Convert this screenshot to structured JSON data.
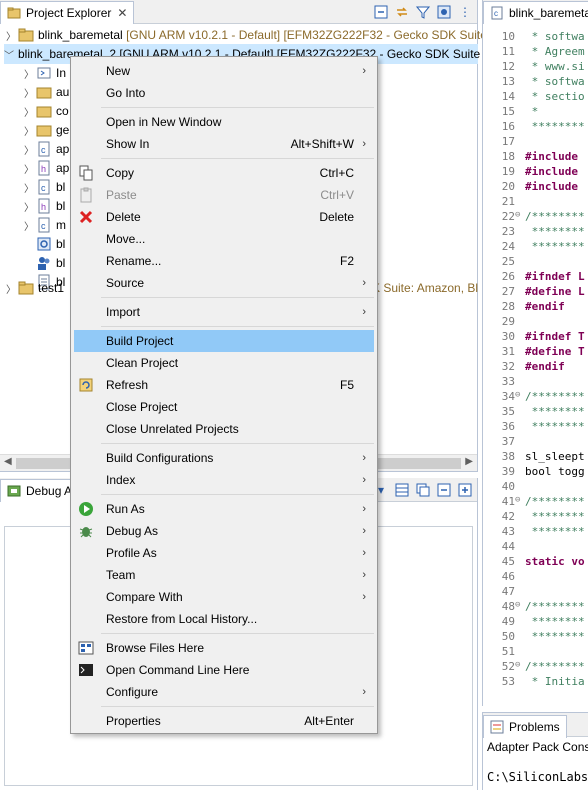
{
  "project_explorer": {
    "tab_title": "Project Explorer",
    "toolbar_icons": [
      "collapse-all-icon",
      "link-with-editor-icon",
      "filter-icon",
      "focus-icon",
      "view-menu-icon"
    ],
    "row1": {
      "name": "blink_baremetal",
      "decoration": "[GNU ARM v10.2.1 - Default] [EFM32ZG222F32 - Gecko SDK Suite:"
    },
    "row2": {
      "name": "blink_baremetal_2",
      "decoration": "[GNU ARM v10.2.1 - Default] [EFM32ZG222F32 - Gecko SDK Suite"
    },
    "children": [
      "In",
      "au",
      "co",
      "ge",
      "ap",
      "ap",
      "bl",
      "bl",
      "m",
      "bl",
      "bl",
      "bl"
    ],
    "row_test": {
      "name": "test1",
      "decoration": "K Suite: Amazon, Bl"
    }
  },
  "debug_adapters": {
    "tab_title": "Debug A"
  },
  "editor": {
    "tab_title": "blink_baremetal",
    "lines": [
      {
        "n": "10",
        "t": " * softwa",
        "c": "com"
      },
      {
        "n": "11",
        "t": " * Agreem",
        "c": "com"
      },
      {
        "n": "12",
        "t": " * www.si",
        "c": "com"
      },
      {
        "n": "13",
        "t": " * softwa",
        "c": "com"
      },
      {
        "n": "14",
        "t": " * sectio",
        "c": "com"
      },
      {
        "n": "15",
        "t": " *",
        "c": "com"
      },
      {
        "n": "16",
        "t": " ********",
        "c": "com"
      },
      {
        "n": "17",
        "t": "",
        "c": "plain"
      },
      {
        "n": "18",
        "t": "#include",
        "c": "dir"
      },
      {
        "n": "19",
        "t": "#include",
        "c": "dir"
      },
      {
        "n": "20",
        "t": "#include",
        "c": "dir"
      },
      {
        "n": "21",
        "t": "",
        "c": "plain"
      },
      {
        "n": "22",
        "t": "/********",
        "c": "com",
        "fold": true
      },
      {
        "n": "23",
        "t": " ********",
        "c": "com"
      },
      {
        "n": "24",
        "t": " ********",
        "c": "com"
      },
      {
        "n": "25",
        "t": "",
        "c": "plain"
      },
      {
        "n": "26",
        "t": "#ifndef L",
        "c": "dir"
      },
      {
        "n": "27",
        "t": "#define L",
        "c": "dir"
      },
      {
        "n": "28",
        "t": "#endif",
        "c": "dir"
      },
      {
        "n": "29",
        "t": "",
        "c": "plain"
      },
      {
        "n": "30",
        "t": "#ifndef T",
        "c": "dir"
      },
      {
        "n": "31",
        "t": "#define T",
        "c": "dir"
      },
      {
        "n": "32",
        "t": "#endif",
        "c": "dir"
      },
      {
        "n": "33",
        "t": "",
        "c": "plain"
      },
      {
        "n": "34",
        "t": "/********",
        "c": "com",
        "fold": true
      },
      {
        "n": "35",
        "t": " ********",
        "c": "com"
      },
      {
        "n": "36",
        "t": " ********",
        "c": "com"
      },
      {
        "n": "37",
        "t": "",
        "c": "plain"
      },
      {
        "n": "38",
        "t": "sl_sleept",
        "c": "plain"
      },
      {
        "n": "39",
        "t": "bool togg",
        "c": "plain"
      },
      {
        "n": "40",
        "t": "",
        "c": "plain"
      },
      {
        "n": "41",
        "t": "/********",
        "c": "com",
        "fold": true
      },
      {
        "n": "42",
        "t": " ********",
        "c": "com"
      },
      {
        "n": "43",
        "t": " ********",
        "c": "com"
      },
      {
        "n": "44",
        "t": "",
        "c": "plain"
      },
      {
        "n": "45",
        "t": "static vo",
        "c": "kw"
      },
      {
        "n": "46",
        "t": "",
        "c": "plain"
      },
      {
        "n": "47",
        "t": "",
        "c": "plain"
      },
      {
        "n": "48",
        "t": "/********",
        "c": "com",
        "fold": true
      },
      {
        "n": "49",
        "t": " ********",
        "c": "com"
      },
      {
        "n": "50",
        "t": " ********",
        "c": "com"
      },
      {
        "n": "51",
        "t": "",
        "c": "plain"
      },
      {
        "n": "52",
        "t": "/********",
        "c": "com",
        "fold": true
      },
      {
        "n": "53",
        "t": " * Initia",
        "c": "com"
      }
    ]
  },
  "problems": {
    "tab_title": "Problems",
    "adapter_line": "Adapter Pack Conso",
    "path_line": "C:\\SiliconLabs\\"
  },
  "context_menu": {
    "items": [
      {
        "label": "New",
        "shortcut": "",
        "submenu": true,
        "icon": ""
      },
      {
        "label": "Go Into",
        "shortcut": "",
        "submenu": false,
        "icon": ""
      },
      {
        "sep": true
      },
      {
        "label": "Open in New Window",
        "shortcut": "",
        "submenu": false,
        "icon": ""
      },
      {
        "label": "Show In",
        "shortcut": "Alt+Shift+W",
        "submenu": true,
        "icon": ""
      },
      {
        "sep": true
      },
      {
        "label": "Copy",
        "shortcut": "Ctrl+C",
        "submenu": false,
        "icon": "copy-icon"
      },
      {
        "label": "Paste",
        "shortcut": "Ctrl+V",
        "submenu": false,
        "icon": "paste-icon",
        "disabled": true
      },
      {
        "label": "Delete",
        "shortcut": "Delete",
        "submenu": false,
        "icon": "delete-icon"
      },
      {
        "label": "Move...",
        "shortcut": "",
        "submenu": false,
        "icon": ""
      },
      {
        "label": "Rename...",
        "shortcut": "F2",
        "submenu": false,
        "icon": ""
      },
      {
        "label": "Source",
        "shortcut": "",
        "submenu": true,
        "icon": ""
      },
      {
        "sep": true
      },
      {
        "label": "Import",
        "shortcut": "",
        "submenu": true,
        "icon": ""
      },
      {
        "sep": true
      },
      {
        "label": "Build Project",
        "shortcut": "",
        "submenu": false,
        "icon": "",
        "highlight": true
      },
      {
        "label": "Clean Project",
        "shortcut": "",
        "submenu": false,
        "icon": ""
      },
      {
        "label": "Refresh",
        "shortcut": "F5",
        "submenu": false,
        "icon": "refresh-icon"
      },
      {
        "label": "Close Project",
        "shortcut": "",
        "submenu": false,
        "icon": ""
      },
      {
        "label": "Close Unrelated Projects",
        "shortcut": "",
        "submenu": false,
        "icon": ""
      },
      {
        "sep": true
      },
      {
        "label": "Build Configurations",
        "shortcut": "",
        "submenu": true,
        "icon": ""
      },
      {
        "label": "Index",
        "shortcut": "",
        "submenu": true,
        "icon": ""
      },
      {
        "sep": true
      },
      {
        "label": "Run As",
        "shortcut": "",
        "submenu": true,
        "icon": "run-icon"
      },
      {
        "label": "Debug As",
        "shortcut": "",
        "submenu": true,
        "icon": "bug-icon"
      },
      {
        "label": "Profile As",
        "shortcut": "",
        "submenu": true,
        "icon": ""
      },
      {
        "label": "Team",
        "shortcut": "",
        "submenu": true,
        "icon": ""
      },
      {
        "label": "Compare With",
        "shortcut": "",
        "submenu": true,
        "icon": ""
      },
      {
        "label": "Restore from Local History...",
        "shortcut": "",
        "submenu": false,
        "icon": ""
      },
      {
        "sep": true
      },
      {
        "label": "Browse Files Here",
        "shortcut": "",
        "submenu": false,
        "icon": "browse-files-icon"
      },
      {
        "label": "Open Command Line Here",
        "shortcut": "",
        "submenu": false,
        "icon": "terminal-icon"
      },
      {
        "label": "Configure",
        "shortcut": "",
        "submenu": true,
        "icon": ""
      },
      {
        "sep": true
      },
      {
        "label": "Properties",
        "shortcut": "Alt+Enter",
        "submenu": false,
        "icon": ""
      }
    ]
  },
  "colors": {
    "menu_highlight": "#91c9f7",
    "selected_row": "#cce8ff",
    "decoration": "#8b6a2b"
  }
}
